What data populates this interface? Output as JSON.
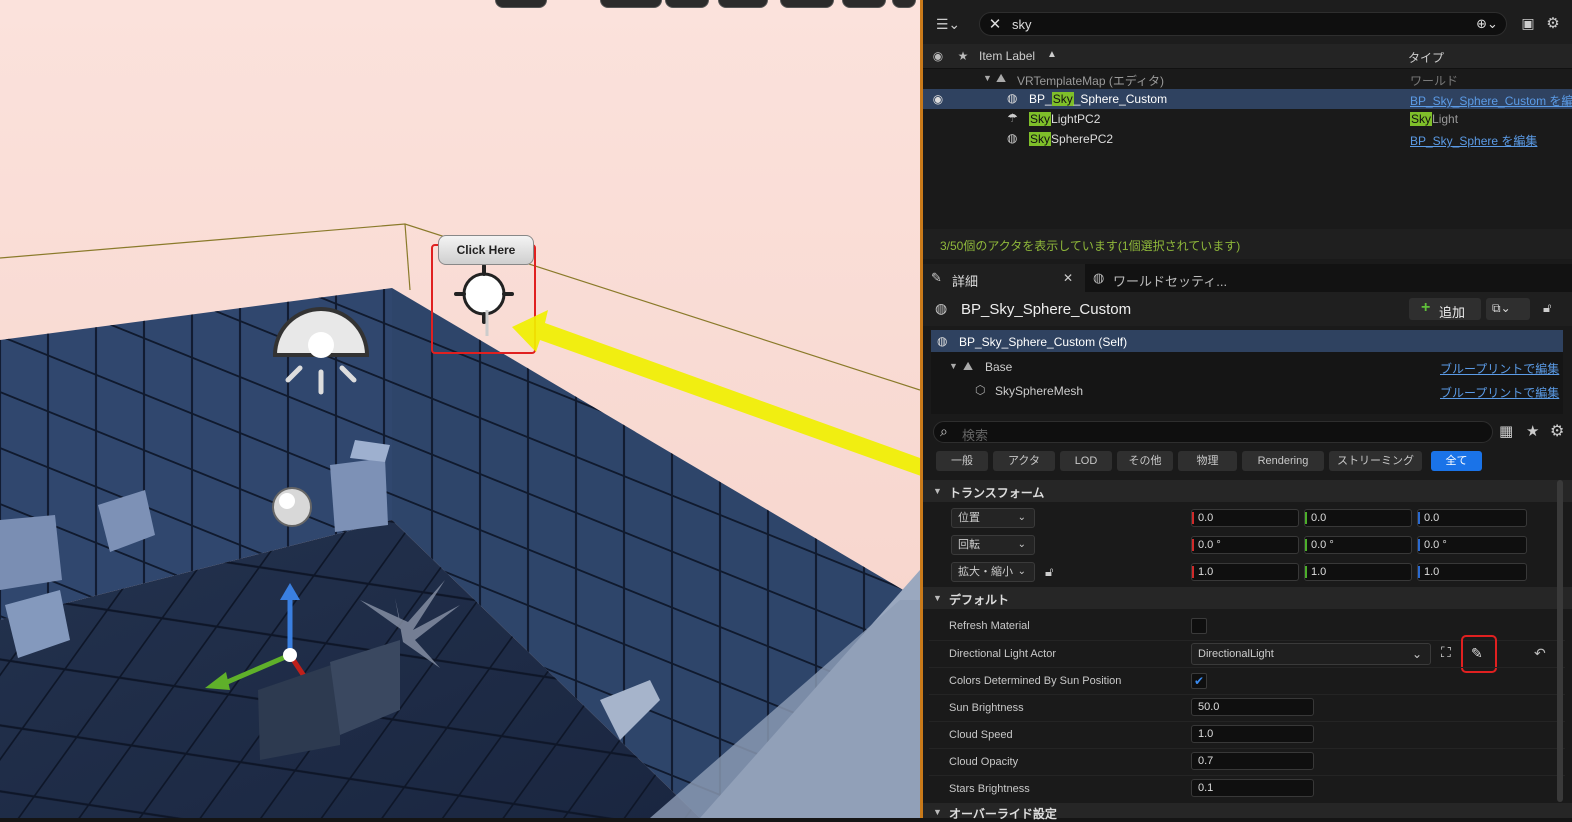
{
  "viewport": {
    "tooltip": "Click Here"
  },
  "outliner": {
    "search_value": "sky",
    "column_label": "Item Label",
    "column_type": "タイプ",
    "world": {
      "label": "VRTemplateMap (エディタ)",
      "type": "ワールド"
    },
    "rows": [
      {
        "pre": "BP_",
        "hl": "Sky",
        "post": "_Sphere_Custom",
        "type_text": "BP_Sky_Sphere_Custom を編",
        "type_is_link": true
      },
      {
        "pre": "",
        "hl": "Sky",
        "post": "LightPC2",
        "type_hl": "Sky",
        "type_post": "Light",
        "type_is_link": false
      },
      {
        "pre": "",
        "hl": "Sky",
        "post": "SpherePC2",
        "type_text": "BP_Sky_Sphere を編集",
        "type_is_link": true
      }
    ],
    "status": "3/50個のアクタを表示しています(1個選択されています)"
  },
  "details": {
    "tab_details": "詳細",
    "tab_world": "ワールドセッティ...",
    "actor_name": "BP_Sky_Sphere_Custom",
    "add_button": "追加",
    "self_label": "BP_Sky_Sphere_Custom (Self)",
    "components": [
      {
        "label": "Base",
        "link": "ブループリントで編集"
      },
      {
        "label": "SkySphereMesh",
        "link": "ブループリントで編集"
      }
    ],
    "search_placeholder": "検索",
    "filters": [
      "一般",
      "アクタ",
      "LOD",
      "その他",
      "物理",
      "Rendering",
      "ストリーミング",
      "全て"
    ],
    "active_filter": "全て",
    "transform_section": "トランスフォーム",
    "location_label": "位置",
    "rotation_label": "回転",
    "scale_label": "拡大・縮小",
    "location": [
      "0.0",
      "0.0",
      "0.0"
    ],
    "rotation": [
      "0.0 °",
      "0.0 °",
      "0.0 °"
    ],
    "scale": [
      "1.0",
      "1.0",
      "1.0"
    ],
    "default_section": "デフォルト",
    "refresh_material": "Refresh Material",
    "directional_light_actor": "Directional Light Actor",
    "directional_light_value": "DirectionalLight",
    "colors_by_sun": "Colors Determined By Sun Position",
    "sun_brightness_label": "Sun Brightness",
    "sun_brightness": "50.0",
    "cloud_speed_label": "Cloud Speed",
    "cloud_speed": "1.0",
    "cloud_opacity_label": "Cloud Opacity",
    "cloud_opacity": "0.7",
    "stars_brightness_label": "Stars Brightness",
    "stars_brightness": "0.1",
    "override_section": "オーバーライド設定"
  },
  "colors": {
    "accent": "#1a73e8",
    "highlight": "#7fbf2a",
    "annotation": "#e02020",
    "arrow": "#f0f000"
  }
}
